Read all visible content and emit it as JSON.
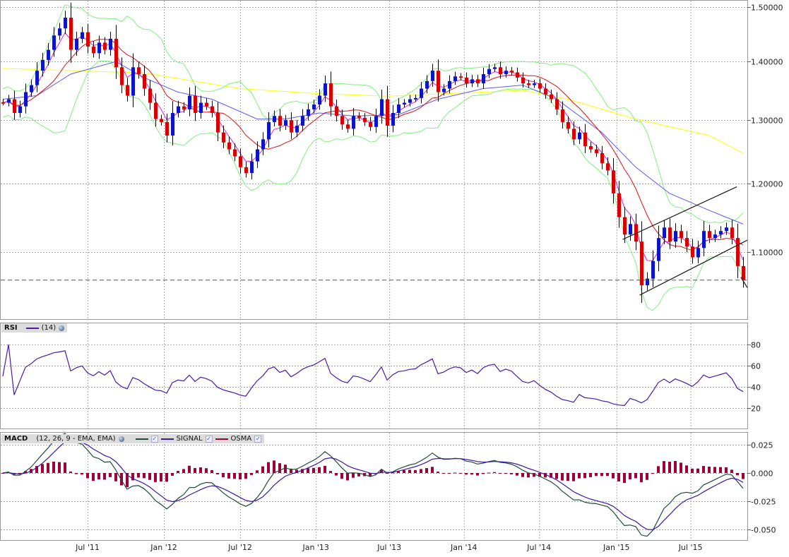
{
  "chart_data": {
    "type": "candlestick",
    "instrument_scale": "log",
    "price_axis": {
      "ticks": [
        "1.50000",
        "1.40000",
        "1.30000",
        "1.20000",
        "1.10000"
      ],
      "tick_values": [
        1.5,
        1.4,
        1.3,
        1.2,
        1.1
      ]
    },
    "x_axis": {
      "labels": [
        "Jul '11",
        "Jan '12",
        "Jul '12",
        "Jan '13",
        "Jul '13",
        "Jan '14",
        "Jul '14",
        "Jan '15",
        "Jul '15"
      ],
      "label_candle_index": [
        15,
        28.5,
        42,
        55.4,
        68.4,
        81.6,
        94.9,
        108.6,
        121.7
      ]
    },
    "closes": [
      1.329,
      1.335,
      1.312,
      1.323,
      1.347,
      1.359,
      1.384,
      1.403,
      1.421,
      1.447,
      1.46,
      1.48,
      1.421,
      1.441,
      1.453,
      1.427,
      1.415,
      1.434,
      1.421,
      1.441,
      1.39,
      1.359,
      1.341,
      1.39,
      1.378,
      1.353,
      1.329,
      1.302,
      1.297,
      1.275,
      1.312,
      1.323,
      1.318,
      1.341,
      1.312,
      1.329,
      1.323,
      1.312,
      1.28,
      1.264,
      1.253,
      1.242,
      1.225,
      1.216,
      1.234,
      1.253,
      1.269,
      1.297,
      1.307,
      1.291,
      1.3,
      1.28,
      1.291,
      1.307,
      1.318,
      1.326,
      1.341,
      1.362,
      1.323,
      1.307,
      1.293,
      1.286,
      1.307,
      1.304,
      1.297,
      1.289,
      1.307,
      1.335,
      1.291,
      1.312,
      1.326,
      1.329,
      1.335,
      1.337,
      1.353,
      1.366,
      1.384,
      1.347,
      1.353,
      1.366,
      1.374,
      1.372,
      1.362,
      1.369,
      1.362,
      1.378,
      1.387,
      1.39,
      1.378,
      1.384,
      1.381,
      1.372,
      1.362,
      1.359,
      1.362,
      1.353,
      1.343,
      1.335,
      1.318,
      1.297,
      1.286,
      1.269,
      1.28,
      1.258,
      1.253,
      1.247,
      1.231,
      1.22,
      1.185,
      1.15,
      1.125,
      1.14,
      1.115,
      1.055,
      1.064,
      1.088,
      1.12,
      1.135,
      1.115,
      1.13,
      1.12,
      1.108,
      1.093,
      1.106,
      1.13,
      1.12,
      1.125,
      1.13,
      1.135,
      1.12,
      1.081,
      1.062
    ],
    "first_open": 1.33,
    "slow_ma": [
      [
        0,
        1.388
      ],
      [
        25,
        1.38
      ],
      [
        42,
        1.353
      ],
      [
        55,
        1.345
      ],
      [
        68,
        1.34
      ],
      [
        80,
        1.345
      ],
      [
        92,
        1.35
      ],
      [
        100,
        1.335
      ],
      [
        112,
        1.302
      ],
      [
        125,
        1.275
      ],
      [
        131,
        1.247
      ]
    ],
    "mid_ma": [
      [
        0,
        1.335
      ],
      [
        6,
        1.341
      ],
      [
        12,
        1.378
      ],
      [
        20,
        1.4
      ],
      [
        25,
        1.372
      ],
      [
        31,
        1.347
      ],
      [
        37,
        1.335
      ],
      [
        45,
        1.302
      ],
      [
        50,
        1.302
      ],
      [
        56,
        1.312
      ],
      [
        62,
        1.307
      ],
      [
        70,
        1.309
      ],
      [
        77,
        1.335
      ],
      [
        85,
        1.353
      ],
      [
        92,
        1.359
      ],
      [
        98,
        1.335
      ],
      [
        106,
        1.28
      ],
      [
        112,
        1.225
      ],
      [
        118,
        1.185
      ],
      [
        125,
        1.16
      ],
      [
        131,
        1.14
      ]
    ],
    "current_price": 1.062,
    "trendlines": [
      {
        "from": [
          109.7,
          1.118
        ],
        "to": [
          129.9,
          1.195
        ]
      },
      {
        "from": [
          112.7,
          1.042
        ],
        "to": [
          131.9,
          1.117
        ]
      },
      {
        "from": [
          130.6,
          1.066
        ],
        "to": [
          131.9,
          1.052
        ]
      }
    ],
    "rsi": {
      "title": "RSI",
      "params": "(14)",
      "ticks": [
        "80",
        "60",
        "40",
        "20"
      ],
      "tick_values": [
        80,
        60,
        40,
        20
      ]
    },
    "macd": {
      "title": "MACD",
      "params": "(12, 26, 9 - EMA, EMA)",
      "signal_label": "SIGNAL",
      "osma_label": "OSMA",
      "ticks": [
        "0.025",
        "0.000",
        "-0.025",
        "-0.050"
      ],
      "tick_values": [
        0.025,
        0,
        -0.025,
        -0.05
      ]
    },
    "colors": {
      "up": "#0a14c8",
      "down": "#d90000",
      "slow_ma": "#ffff00",
      "mid_ma": "#5a5aff",
      "fast_ma": "#e01010",
      "ema": "#e020e0",
      "bands": "#80f080",
      "rsi": "#4a1aa8",
      "macd": "#1f4a3c",
      "signal": "#3a18a8",
      "osma": "#a0003a"
    }
  }
}
